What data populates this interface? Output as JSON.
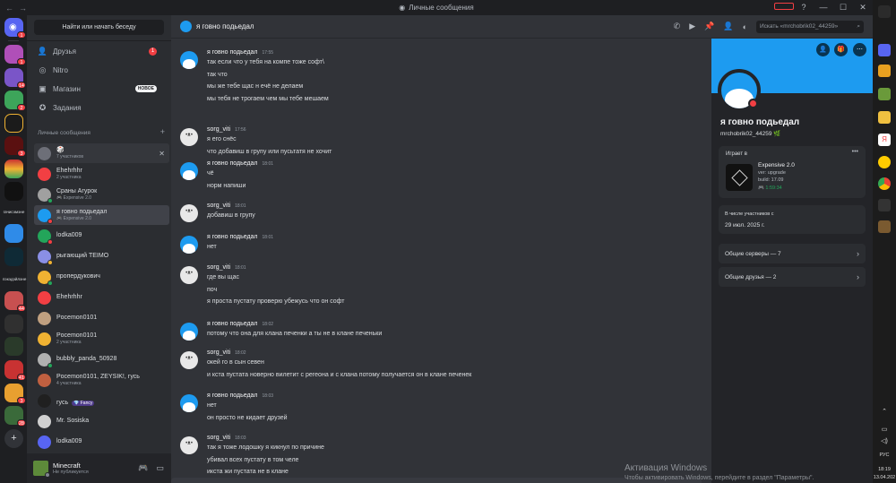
{
  "window": {
    "title": "Личные сообщения"
  },
  "servers": {
    "badges": [
      "1",
      "14",
      "2",
      "3",
      "44",
      "41",
      "3",
      "28"
    ],
    "labels": [
      "гачисэмэне",
      "пэкэдэйлэне"
    ]
  },
  "sidebar": {
    "search_button": "Найти или начать беседу",
    "nav": [
      {
        "label": "Друзья",
        "icon": "friends-icon",
        "badge": "1"
      },
      {
        "label": "Nitro",
        "icon": "nitro-icon"
      },
      {
        "label": "Магазин",
        "icon": "shop-icon",
        "tag": "НОВОЕ"
      },
      {
        "label": "Задания",
        "icon": "quests-icon"
      }
    ],
    "dm_header": "Личные сообщения",
    "dm_add": "+",
    "dms": [
      {
        "name": "🎲",
        "sub": "7 участников",
        "av": "#6d6f78",
        "close": "✕"
      },
      {
        "name": "Ehehrhhr",
        "sub": "2 участника",
        "av": "#f23f43"
      },
      {
        "name": "Сраны Агурок",
        "sub": "🎮 Expensive 2.0",
        "av": "#a0a0a0",
        "status": "#23a55a"
      },
      {
        "name": "я говно подьедал",
        "sub": "🎮 Expensive 2.0",
        "av": "#1d9bf0",
        "status": "#f23f43"
      },
      {
        "name": "lodka009",
        "sub": "",
        "av": "#23a55a",
        "status": "#f23f43"
      },
      {
        "name": "рыгающий TEIMO",
        "sub": "",
        "av": "#8a8fe6",
        "status": "#f0b232"
      },
      {
        "name": "пропердукович",
        "sub": "",
        "av": "#f0b232",
        "status": "#23a55a"
      },
      {
        "name": "Ehehrhhr",
        "sub": "",
        "av": "#f23f43"
      },
      {
        "name": "Pocemon0101",
        "sub": "",
        "av": "#c0a080"
      },
      {
        "name": "Pocemon0101",
        "sub": "2 участника",
        "av": "#f0b232"
      },
      {
        "name": "bubbly_panda_50928",
        "sub": "",
        "av": "#b0b0b0",
        "status": "#23a55a"
      },
      {
        "name": "Pocemon0101, ZEYSIK!, гусь",
        "sub": "4 участника",
        "av": "#c06040"
      },
      {
        "name": "гусь",
        "sub": "",
        "tag": "💎 Fancy",
        "av": "#202020"
      },
      {
        "name": "Mr. Sosiska",
        "sub": "",
        "av": "#d0d0d0"
      },
      {
        "name": "lodka009",
        "sub": "",
        "av": "#5865f2"
      }
    ]
  },
  "user": {
    "name": "Minecraft",
    "status": "Не публикуется"
  },
  "chat": {
    "channel_name": "я говно подьедал",
    "search_placeholder": "Искать «mrchobrik02_44259»",
    "messages": [
      {
        "author": "я говно подьедал",
        "time": "17:55",
        "av": "blue",
        "lines": [
          "так если что у тебя на компе тоже софт\\",
          "так что",
          "мы же тебе щас н ечё не делаем",
          "мы тебя не трогаем чем мы тебе мешаем"
        ]
      },
      {
        "author": "sorg_viti",
        "time": "17:56",
        "av": "cat",
        "lines": [
          "я его снёс",
          "что добавиш в групу или пусьтатя не хочит"
        ]
      },
      {
        "author": "я говно подьедал",
        "time": "18:01",
        "av": "blue",
        "lines": [
          "чё",
          "норм напиши"
        ]
      },
      {
        "author": "sorg_viti",
        "time": "18:01",
        "av": "cat",
        "lines": [
          "добавиш в групу"
        ]
      },
      {
        "author": "я говно подьедал",
        "time": "18:01",
        "av": "blue",
        "lines": [
          "нет"
        ]
      },
      {
        "author": "sorg_viti",
        "time": "18:01",
        "av": "cat",
        "lines": [
          "где вы щас",
          "поч",
          "я проста пустату проверю убежусь что он софт"
        ]
      },
      {
        "author": "я говно подьедал",
        "time": "18:02",
        "av": "blue",
        "lines": [
          "потому что она для клана печенки а ты не в клане печеньки"
        ]
      },
      {
        "author": "sorg_viti",
        "time": "18:02",
        "av": "cat",
        "lines": [
          "окей го в сын севен",
          "и кста пустата новерно вилетит с регеона и с клана потому получается он в клане печенек"
        ]
      },
      {
        "author": "я говно подьедал",
        "time": "18:03",
        "av": "blue",
        "lines": [
          "нет",
          "он просто не кидает друзей"
        ]
      },
      {
        "author": "sorg_viti",
        "time": "18:03",
        "av": "cat",
        "lines": [
          "так я тоже лодошку я кикнул по причине",
          "убивал всех пустату в том челе",
          "икста жи пустата не в клане"
        ]
      }
    ]
  },
  "profile": {
    "name": "я говно подьедал",
    "username": "mrchobrik02_44259",
    "playing_label": "Играет в",
    "game_name": "Expensive 2.0",
    "game_ver": "ver: upgrade",
    "game_build": "build: 17.09",
    "game_time": "🎮 1:59:34",
    "member_since_label": "В числе участников с",
    "member_since": "29 июл. 2025 г.",
    "mutual_servers": "Общие серверы — 7",
    "mutual_friends": "Общие друзья — 2",
    "more": "•••"
  },
  "watermark": {
    "title": "Активация Windows",
    "sub": "Чтобы активировать Windows, перейдите в раздел \"Параметры\"."
  },
  "taskbar": {
    "lang": "РУС",
    "time": "18:19",
    "date": "13.04.202"
  },
  "colors": {
    "accent": "#5865f2",
    "danger": "#f23f43",
    "online": "#23a55a",
    "banner": "#1d9bf0"
  }
}
